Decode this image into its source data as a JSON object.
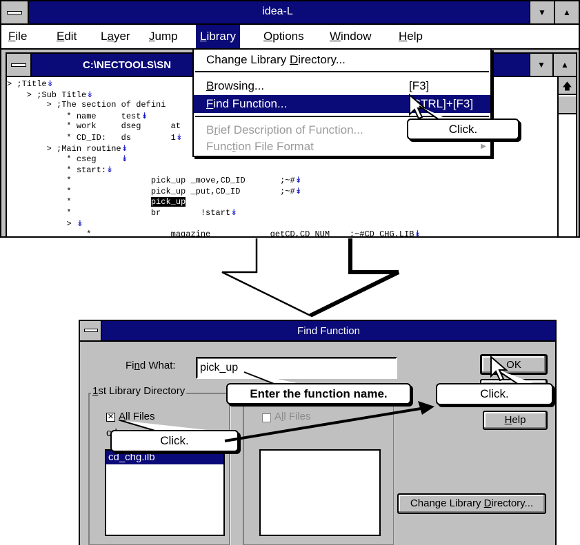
{
  "app": {
    "title": "idea-L",
    "menu": [
      {
        "label": "File",
        "key": "F",
        "rest": "ile"
      },
      {
        "label": "Edit",
        "key": "E",
        "rest": "dit"
      },
      {
        "label": "Layer",
        "key": "a",
        "pre": "L",
        "rest": "yer"
      },
      {
        "label": "Jump",
        "key": "J",
        "rest": "ump"
      },
      {
        "label": "Library",
        "key": "L",
        "rest": "ibrary"
      },
      {
        "label": "Options",
        "key": "O",
        "rest": "ptions"
      },
      {
        "label": "Window",
        "key": "W",
        "rest": "indow"
      },
      {
        "label": "Help",
        "key": "H",
        "rest": "elp"
      }
    ]
  },
  "document": {
    "title": "C:\\NECTOOLS\\SN",
    "lines": [
      {
        "text": "> ;Title",
        "arrow": true
      },
      {
        "text": "    > ;Sub Title",
        "arrow": true
      },
      {
        "text": "        > ;The section of defini",
        "arrow": false
      },
      {
        "text": "            * name     test",
        "arrow": true
      },
      {
        "text": "            * work     dseg      at",
        "arrow": false
      },
      {
        "text": "            * CD_ID:   ds        1",
        "arrow": true
      },
      {
        "text": "        > ;Main routine",
        "arrow": true
      },
      {
        "text": "            * cseg     ",
        "arrow": true
      },
      {
        "text": "            * start:",
        "arrow": true
      },
      {
        "text": "            *                pick_up _move,CD_ID       ;~#",
        "arrow": true
      },
      {
        "text": "            *                pick_up _put,CD_ID        ;~#",
        "arrow": true
      },
      {
        "text": "            *",
        "highlight": "pick_up",
        "pad": "                ",
        "arrow": false
      },
      {
        "text": "            *                br        !start",
        "arrow": true
      },
      {
        "text": "            > ",
        "arrow": true
      },
      {
        "text": "                *                magazine            getCD,CD_NUM    ;~#CD_CHG.LIB",
        "arrow": true
      }
    ]
  },
  "library_menu": {
    "items": [
      {
        "pre": "Change Library ",
        "key": "D",
        "post": "irectory...",
        "accel": "",
        "state": "normal"
      },
      {
        "pre": "",
        "key": "B",
        "post": "rowsing...",
        "accel": "[F3]",
        "state": "normal"
      },
      {
        "pre": "",
        "key": "F",
        "post": "ind Function...",
        "accel": "[CTRL]+[F3]",
        "state": "selected"
      },
      {
        "pre": "B",
        "key": "r",
        "post": "ief Description of Function...",
        "accel": "",
        "state": "disabled"
      },
      {
        "pre": "Func",
        "key": "t",
        "post": "ion File Format",
        "accel": "",
        "state": "disabled"
      }
    ]
  },
  "dialog": {
    "title": "Find Function",
    "find_label_pre": "Fi",
    "find_label_key": "n",
    "find_label_post": "d What:",
    "find_value": "pick_up",
    "group1_pre": "",
    "group1_key": "1",
    "group1_post": "st Library Directory",
    "all_files_label_key": "A",
    "all_files_label_post": "ll Files",
    "all_files_checked": "✕",
    "partial_label": "cd",
    "file_items": [
      "cd_chg.ilb"
    ],
    "group2_all_files_pre": "A",
    "group2_all_files_key": "l",
    "group2_all_files_post": "l Files",
    "ok_label": "OK",
    "help_label_key": "H",
    "help_label_post": "elp",
    "change_dir_pre": "Change Library ",
    "change_dir_key": "D",
    "change_dir_post": "irectory..."
  },
  "callouts": {
    "menu_click": "Click.",
    "enter_name": "Enter the function name.",
    "ok_click": "Click.",
    "all_files_click": "Click."
  },
  "colors": {
    "titlebar": "#0a0a78",
    "selection": "#0a0a78",
    "face": "#c0c0c0",
    "arrow_glyph": "#1010c8"
  }
}
